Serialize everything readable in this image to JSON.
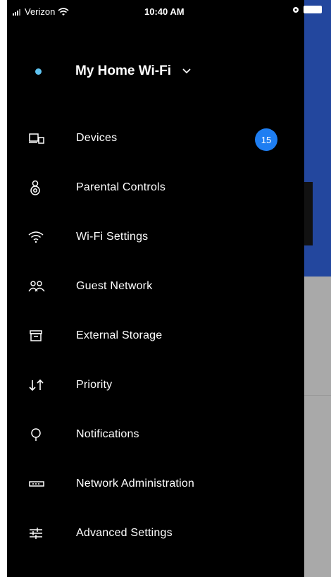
{
  "status_bar": {
    "carrier": "Verizon",
    "time": "10:40 AM"
  },
  "header": {
    "network_name": "My Home Wi-Fi",
    "status_color": "#5fc3f0"
  },
  "menu": {
    "items": [
      {
        "label": "Devices",
        "icon": "devices-icon",
        "badge": "15"
      },
      {
        "label": "Parental Controls",
        "icon": "parental-controls-icon"
      },
      {
        "label": "Wi-Fi Settings",
        "icon": "wifi-icon"
      },
      {
        "label": "Guest Network",
        "icon": "guest-network-icon"
      },
      {
        "label": "External Storage",
        "icon": "external-storage-icon"
      },
      {
        "label": "Priority",
        "icon": "priority-icon"
      },
      {
        "label": "Notifications",
        "icon": "notifications-icon"
      },
      {
        "label": "Network Administration",
        "icon": "router-icon"
      },
      {
        "label": "Advanced Settings",
        "icon": "sliders-icon"
      }
    ]
  },
  "colors": {
    "drawer_bg": "#000000",
    "badge_bg": "#1e7ef2",
    "underlying_blue": "#23479e"
  }
}
